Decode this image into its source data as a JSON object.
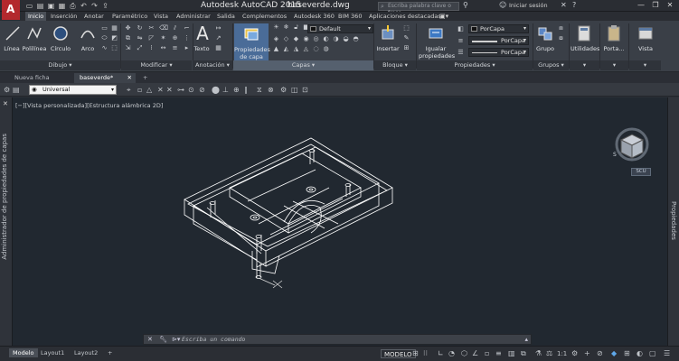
{
  "title": {
    "app": "Autodesk AutoCAD 2015",
    "file": "baseverde.dwg"
  },
  "search": {
    "placeholder": "Escriba palabra clave o frase"
  },
  "login": "Iniciar sesión",
  "ribbon_tabs": [
    "Inicio",
    "Inserción",
    "Anotar",
    "Paramétrico",
    "Vista",
    "Administrar",
    "Salida",
    "Complementos",
    "Autodesk 360",
    "BIM 360",
    "Aplicaciones destacadas"
  ],
  "tools": {
    "linea": "Línea",
    "polilinea": "Polilínea",
    "circulo": "Círculo",
    "arco": "Arco",
    "texto": "Texto",
    "propiedades_capa": [
      "Propiedades",
      "de capa"
    ],
    "insertar": "Insertar",
    "igualar": [
      "Igualar",
      "propiedades"
    ],
    "grupo": "Grupo",
    "utilidades": "Utilidades",
    "portapapeles": "Porta...",
    "vista": "Vista"
  },
  "layer_combo": "Default",
  "prop_combos": [
    "PorCapa",
    "PorCapa",
    "PorCapa"
  ],
  "panels": [
    "Dibujo ▾",
    "Modificar ▾",
    "Anotación ▾",
    "Capas ▾",
    "Bloque ▾",
    "Propiedades ▾",
    "Grupos ▾"
  ],
  "doc_tabs": [
    "Nueva ficha",
    "baseverde*"
  ],
  "workspace": "Universal",
  "viewport_label": "[−][Vista personalizada][Estructura alámbrica 2D]",
  "left_palette": "Administrador de propiedades de capas",
  "right_palette": "Propiedades",
  "viewcube": {
    "wcs": "SCU",
    "south": "S"
  },
  "command": {
    "placeholder": "Escriba un comando"
  },
  "layout_tabs": [
    "Modelo",
    "Layout1",
    "Layout2",
    "+"
  ],
  "status": {
    "model": "MODELO",
    "scale": "1:1"
  },
  "colors": {
    "accent": "#b3282d",
    "canvas": "#212830",
    "wire": "#ffffff"
  }
}
